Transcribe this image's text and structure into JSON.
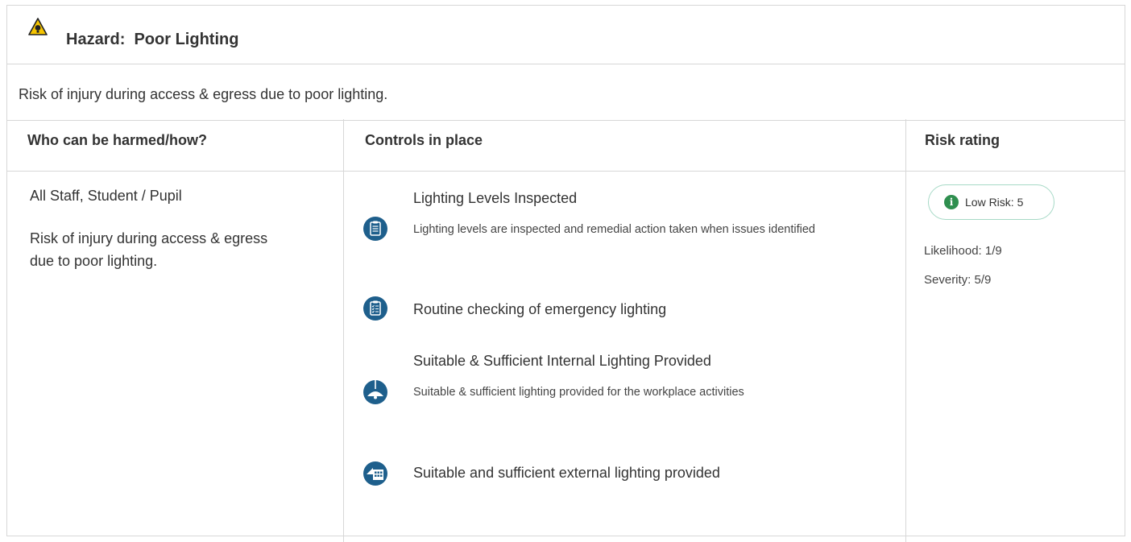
{
  "hazard": {
    "title": "Hazard:  Poor Lighting",
    "description": "Risk of injury during access & egress due to poor lighting."
  },
  "table": {
    "headers": {
      "who": "Who can be harmed/how?",
      "controls": "Controls in place",
      "risk": "Risk rating"
    },
    "who_harmed": "All Staff, Student / Pupil",
    "how_harmed": "Risk of injury during access & egress due to poor lighting.",
    "controls": [
      {
        "title": "Lighting Levels Inspected",
        "description": "Lighting levels are inspected and remedial action taken when issues identified",
        "icon": "clipboard-icon"
      },
      {
        "title": "Routine checking of emergency lighting",
        "description": "",
        "icon": "checklist-icon"
      },
      {
        "title": "Suitable & Sufficient Internal Lighting Provided",
        "description": "Suitable & sufficient lighting provided for the workplace activities",
        "icon": "ceiling-lamp-icon"
      },
      {
        "title": "Suitable and sufficient external lighting provided",
        "description": "",
        "icon": "building-light-icon"
      }
    ],
    "risk": {
      "badge": "Low Risk: 5",
      "likelihood": "Likelihood: 1/9",
      "severity": "Severity: 5/9",
      "badge_color": "#2f8f4f",
      "badge_border": "#a6d9c6"
    }
  },
  "colors": {
    "icon_blue": "#1e5f8c",
    "warning_yellow": "#f5c400",
    "border": "#d7d7d7"
  }
}
